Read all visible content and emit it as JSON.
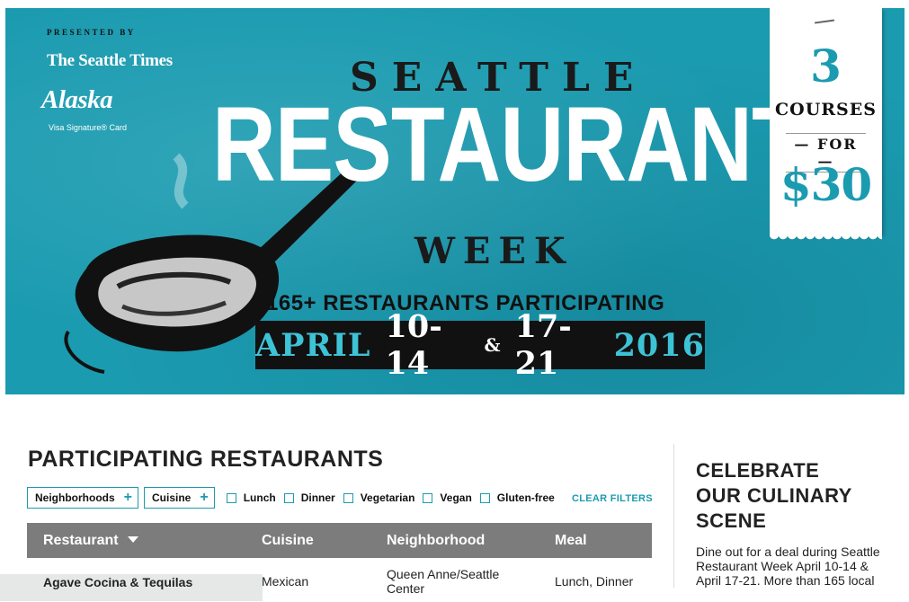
{
  "hero": {
    "presented_by": "PRESENTED BY",
    "sponsor1": "The Seattle Times",
    "sponsor2": "Alaska",
    "sponsor2_sub": "Visa Signature® Card",
    "title_top": "SEATTLE",
    "title_main": "RESTAURANT",
    "title_bottom": "WEEK",
    "count_line": "165+ RESTAURANTS PARTICIPATING",
    "dates": {
      "month": "APRIL",
      "range1": "10-14",
      "amp": "&",
      "range2": "17-21",
      "year": "2016"
    },
    "ticket": {
      "number": "3",
      "courses": "COURSES",
      "for": "— FOR —",
      "price": "$30"
    },
    "colors": {
      "teal": "#1b9bb0",
      "light_teal": "#3dc2d6",
      "black": "#111111"
    }
  },
  "main": {
    "title": "PARTICIPATING RESTAURANTS",
    "filters": {
      "dropdowns": [
        {
          "label": "Neighborhoods",
          "icon": "plus-icon"
        },
        {
          "label": "Cuisine",
          "icon": "plus-icon"
        }
      ],
      "checkboxes": [
        "Lunch",
        "Dinner",
        "Vegetarian",
        "Vegan",
        "Gluten-free"
      ],
      "clear": "CLEAR FILTERS"
    },
    "table": {
      "headers": {
        "restaurant": "Restaurant",
        "cuisine": "Cuisine",
        "neighborhood": "Neighborhood",
        "meal": "Meal"
      },
      "rows": [
        {
          "restaurant": "Agave Cocina & Tequilas",
          "cuisine": "Mexican",
          "neighborhood_line1": "Queen Anne/Seattle",
          "neighborhood_line2": "Center",
          "meal": "Lunch, Dinner"
        }
      ]
    }
  },
  "sidebar": {
    "title_lines": [
      "CELEBRATE",
      "OUR CULINARY",
      "SCENE"
    ],
    "text": "Dine out for a deal during Seattle Restaurant Week April 10-14 & April 17-21. More than 165 local"
  }
}
